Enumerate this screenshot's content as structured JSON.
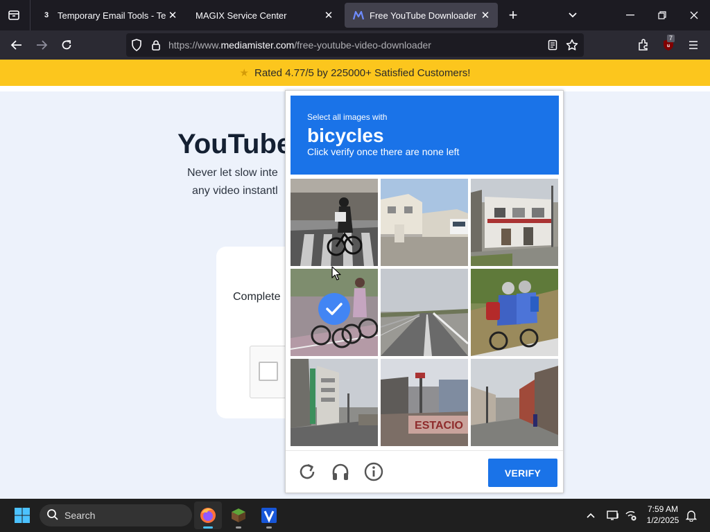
{
  "browser": {
    "tabs": [
      {
        "title": "Temporary Email Tools - Tempo",
        "favicon": "temp-mail-icon",
        "active": false
      },
      {
        "title": "MAGIX Service Center",
        "favicon": "magix-icon",
        "active": false
      },
      {
        "title": "Free YouTube Downloader | Do",
        "favicon": "mediamister-icon",
        "active": true
      }
    ],
    "url_prefix": "https://www.",
    "url_domain": "mediamister.com",
    "url_path": "/free-youtube-video-downloader",
    "extension_badge": "7"
  },
  "page": {
    "banner_text": "Rated 4.77/5 by 225000+ Satisfied Customers!",
    "banner_color": "#fcc61d",
    "hero_title": "YouTube",
    "hero_sub_line1": "Never let slow inte",
    "hero_sub_line2": "any video instantl",
    "card_text": "Complete"
  },
  "captcha": {
    "prompt_pre": "Select all images with",
    "object": "bicycles",
    "prompt_post": "Click verify once there are none left",
    "header_color": "#1a73e8",
    "tiles": [
      {
        "scene": "cyclist-crosswalk",
        "selected": false
      },
      {
        "scene": "house-street",
        "selected": false
      },
      {
        "scene": "building-corner",
        "selected": false
      },
      {
        "scene": "cyclists-riding",
        "selected": true
      },
      {
        "scene": "empty-highway",
        "selected": false
      },
      {
        "scene": "cyclists-backpacks",
        "selected": false
      },
      {
        "scene": "city-street",
        "selected": false
      },
      {
        "scene": "station-sign",
        "selected": false
      },
      {
        "scene": "town-street",
        "selected": false
      }
    ],
    "station_sign_text": "ESTACIO",
    "verify_label": "VERIFY"
  },
  "taskbar": {
    "search_placeholder": "Search",
    "time": "7:59 AM",
    "date": "1/2/2025"
  }
}
